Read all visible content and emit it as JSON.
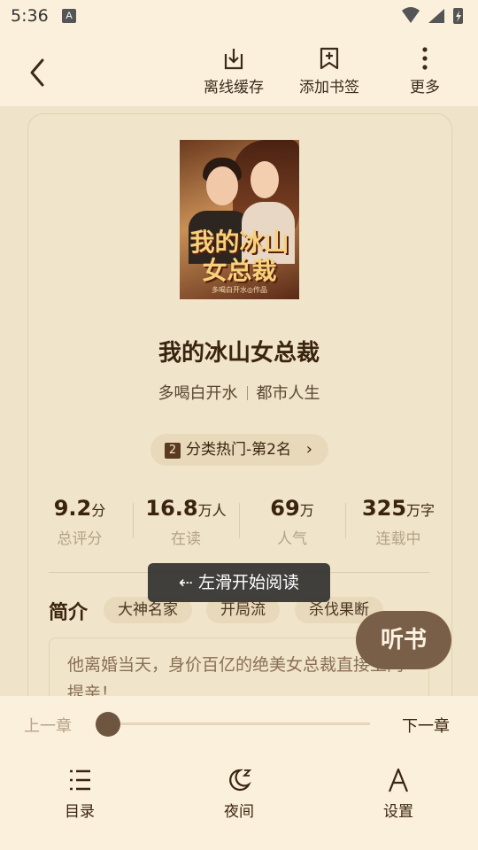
{
  "status": {
    "time": "5:36",
    "notif_icon": "A"
  },
  "toolbar": {
    "offline_label": "离线缓存",
    "bookmark_label": "添加书签",
    "more_label": "更多"
  },
  "book": {
    "cover_title": "我的冰山女总裁",
    "cover_author": "多喝白开水◎作品",
    "title": "我的冰山女总裁",
    "author": "多喝白开水",
    "category": "都市人生",
    "rank_num": "2",
    "rank_text": "分类热门-第2名",
    "stats": [
      {
        "value": "9.2",
        "unit": "分",
        "label": "总评分"
      },
      {
        "value": "16.8",
        "unit": "万人",
        "label": "在读"
      },
      {
        "value": "69",
        "unit": "万",
        "label": "人气"
      },
      {
        "value": "325",
        "unit": "万字",
        "label": "连载中"
      }
    ],
    "intro_label": "简介",
    "tags": [
      "大神名家",
      "开局流",
      "杀伐果断"
    ],
    "intro_text": "他离婚当天，身价百亿的绝美女总裁直接上门提亲！"
  },
  "toast": "⇠ 左滑开始阅读",
  "listen_label": "听书",
  "bottom": {
    "prev_label": "上一章",
    "next_label": "下一章",
    "progress": 0,
    "nav": [
      {
        "label": "目录",
        "icon": "list-icon"
      },
      {
        "label": "夜间",
        "icon": "moon-icon"
      },
      {
        "label": "设置",
        "icon": "font-icon"
      }
    ]
  }
}
